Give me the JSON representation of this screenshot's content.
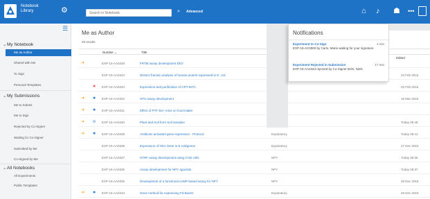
{
  "app": {
    "logo_name": "Notebook",
    "logo_sub": "Library"
  },
  "topbar": {
    "search_placeholder": "Search in Notebook",
    "advanced_label": "Advanced",
    "icons": [
      "home-icon",
      "notification-bell-icon",
      "user-icon",
      "more-icon"
    ]
  },
  "sidebar": {
    "my_notebook": "My Notebook",
    "items_notebook": [
      "Me as Author",
      "Shared with Me",
      "To Sign",
      "Personal Templates"
    ],
    "my_submissions": "My Submissions",
    "items_submissions": [
      "Me to Submit",
      "Me to Sign",
      "Rejected by Co-Signer",
      "Waiting for Co-Signer",
      "Submitted by Me",
      "Co-Signed by Me"
    ],
    "all_notebooks": "All Notebooks",
    "items_all": [
      "All Experiments",
      "Public Templates"
    ]
  },
  "main": {
    "title": "Me as Author",
    "count": "49 results",
    "columns": {
      "number": "Number",
      "title": "Title",
      "date": "Edited"
    },
    "rows": [
      {
        "pin": "➜",
        "icon": "",
        "number": "EXP-15-AA0348",
        "title": "FRTM assay development EEV",
        "status": "",
        "date": ""
      },
      {
        "pin": "",
        "icon": "",
        "number": "EXP-15-AA0344",
        "title": "Distinct fraction analysis of human protein expressed in E. coli",
        "status": "",
        "date": "23 Feb 2015"
      },
      {
        "pin": "",
        "icon": "✱",
        "number": "EXP-15-AA0343",
        "title": "Expression and purification of CRT-9371",
        "status": "",
        "date": "02 Feb 2015"
      },
      {
        "pin": "➜",
        "icon": "✱",
        "number": "EXP-15-AA0342",
        "title": "HTS assay development",
        "status": "",
        "date": "16 Mar 2015"
      },
      {
        "pin": "➜",
        "icon": "✱",
        "number": "EXP-15-AA0341",
        "title": "Effect of PTF-Dx+ mice on food intake",
        "status": "",
        "date": ""
      },
      {
        "pin": "➜",
        "icon": "✉",
        "number": "EXP-15-AA0340",
        "title": "Plant and Soil from Soil samples",
        "status": "Exploratory",
        "date": "Today 09:48"
      },
      {
        "pin": "➜",
        "icon": "✱",
        "number": "EXP-15-AA0339",
        "title": "Antibiotic-activated gene expression - Protocol",
        "status": "Exploratory",
        "date": "Today 08:41"
      },
      {
        "pin": "",
        "icon": "",
        "number": "EXP-15-AA0338",
        "title": "Expression of NS1 Gene in E.coli/genes",
        "status": "Exploratory",
        "date": "27 Dec 2015"
      },
      {
        "pin": "",
        "icon": "",
        "number": "EXP-15-AA0337",
        "title": "HTRF assay development using CHO cells",
        "status": "NPY",
        "date": "Today 09:35"
      },
      {
        "pin": "",
        "icon": "",
        "number": "EXP-15-AA0336",
        "title": "Assay development for NPY agonists",
        "status": "NPY",
        "date": "Today 06:37"
      },
      {
        "pin": "",
        "icon": "",
        "number": "EXP-15-AA0335",
        "title": "Development of a functional cAMP-based assay for NPY",
        "status": "NPY",
        "date": "28 Dec 2015"
      },
      {
        "pin": "➜",
        "icon": "✱",
        "number": "EXP-15-AA0334",
        "title": "Gene method for expressing Fd Bacter",
        "status": "Exploratory",
        "date": "28 Dec 2015"
      }
    ]
  },
  "notifications": {
    "title": "Notifications",
    "items": [
      {
        "heading": "Experiment to Co-Sign",
        "time": "4 min",
        "text": "EXP-15-AC0000 by Carlo, Marie waiting for your signature"
      },
      {
        "heading": "Experiment Rejected in Submission",
        "time": "17 min",
        "text": "EXP-15-AA2343 rejected by Co-Signer Bohr, Niels"
      }
    ]
  },
  "colors": {
    "brand": "#1f73c6",
    "link": "#2a79c8",
    "pin": "#f2a623",
    "danger": "#e25a5a"
  }
}
